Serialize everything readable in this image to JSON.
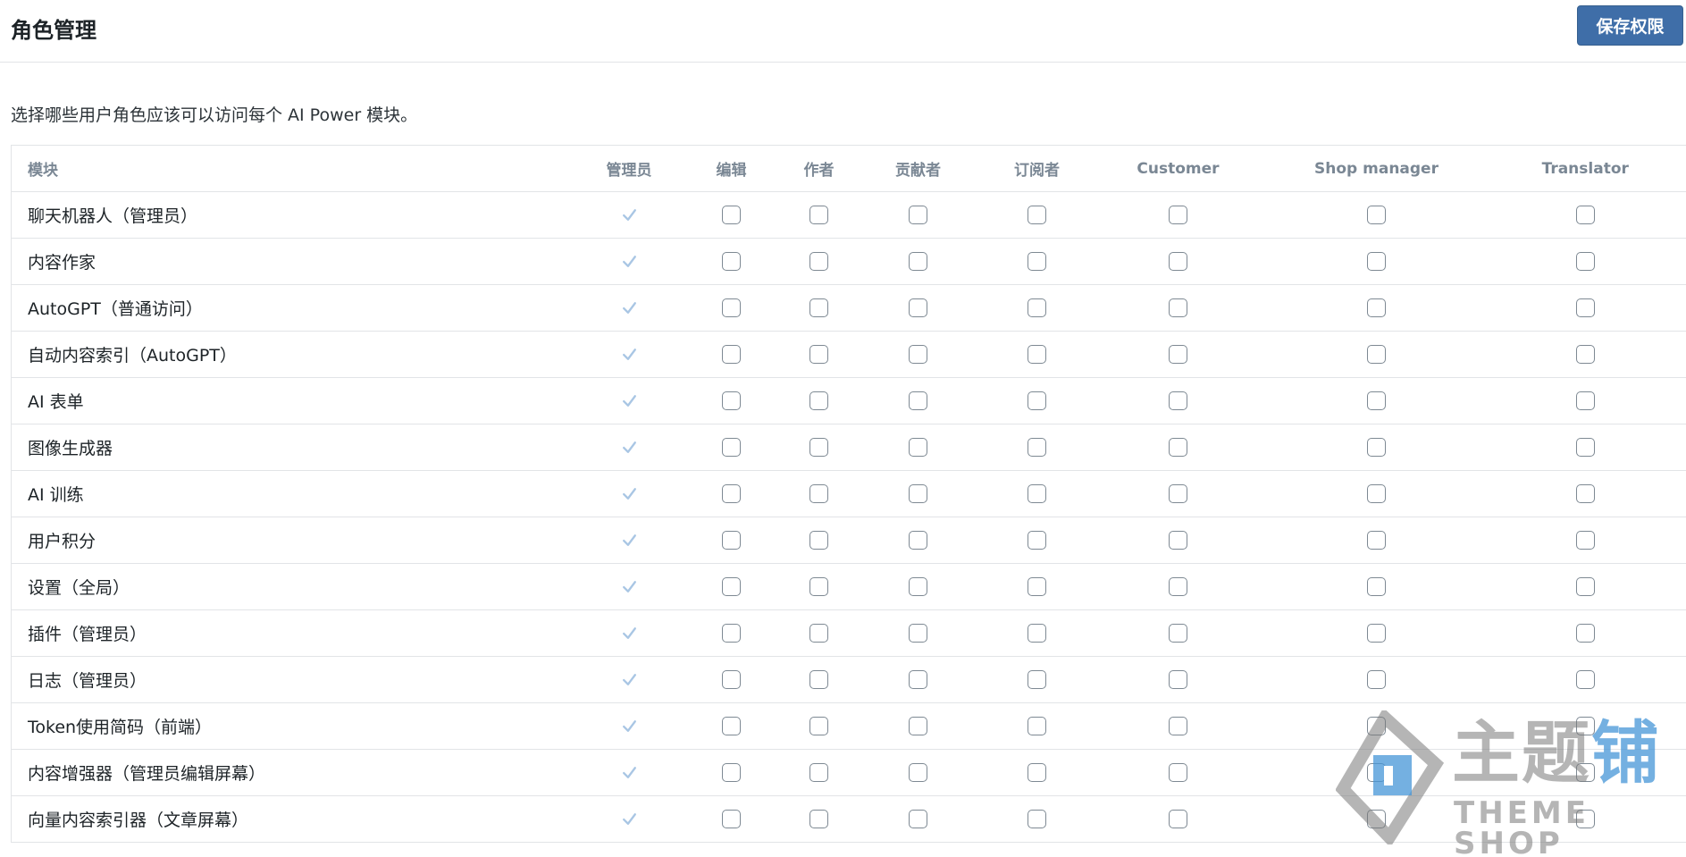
{
  "header": {
    "title": "角色管理",
    "save_label": "保存权限"
  },
  "description": "选择哪些用户角色应该可以访问每个 AI Power 模块。",
  "table": {
    "module_header": "模块",
    "roles": [
      "管理员",
      "编辑",
      "作者",
      "贡献者",
      "订阅者",
      "Customer",
      "Shop manager",
      "Translator"
    ],
    "modules": [
      {
        "name": "聊天机器人（管理员）",
        "checked": [
          true,
          false,
          false,
          false,
          false,
          false,
          false,
          false
        ]
      },
      {
        "name": "内容作家",
        "checked": [
          true,
          false,
          false,
          false,
          false,
          false,
          false,
          false
        ]
      },
      {
        "name": "AutoGPT（普通访问）",
        "checked": [
          true,
          false,
          false,
          false,
          false,
          false,
          false,
          false
        ]
      },
      {
        "name": "自动内容索引（AutoGPT）",
        "checked": [
          true,
          false,
          false,
          false,
          false,
          false,
          false,
          false
        ]
      },
      {
        "name": "AI 表单",
        "checked": [
          true,
          false,
          false,
          false,
          false,
          false,
          false,
          false
        ]
      },
      {
        "name": "图像生成器",
        "checked": [
          true,
          false,
          false,
          false,
          false,
          false,
          false,
          false
        ]
      },
      {
        "name": "AI 训练",
        "checked": [
          true,
          false,
          false,
          false,
          false,
          false,
          false,
          false
        ]
      },
      {
        "name": "用户积分",
        "checked": [
          true,
          false,
          false,
          false,
          false,
          false,
          false,
          false
        ]
      },
      {
        "name": "设置（全局）",
        "checked": [
          true,
          false,
          false,
          false,
          false,
          false,
          false,
          false
        ]
      },
      {
        "name": "插件（管理员）",
        "checked": [
          true,
          false,
          false,
          false,
          false,
          false,
          false,
          false
        ]
      },
      {
        "name": "日志（管理员）",
        "checked": [
          true,
          false,
          false,
          false,
          false,
          false,
          false,
          false
        ]
      },
      {
        "name": "Token使用简码（前端）",
        "checked": [
          true,
          false,
          false,
          false,
          false,
          false,
          false,
          false
        ]
      },
      {
        "name": "内容增强器（管理员编辑屏幕）",
        "checked": [
          true,
          false,
          false,
          false,
          false,
          false,
          false,
          false
        ]
      },
      {
        "name": "向量内容索引器（文章屏幕）",
        "checked": [
          true,
          false,
          false,
          false,
          false,
          false,
          false,
          false
        ]
      }
    ]
  },
  "watermark": {
    "title_gray": "主题",
    "title_blue": "铺",
    "subtitle": "THEME SHOP"
  },
  "colors": {
    "accent": "#3f6ea8",
    "checkmark": "#a9c6e4",
    "border": "#e2e4e7",
    "watermark_blue": "#4696d7"
  }
}
